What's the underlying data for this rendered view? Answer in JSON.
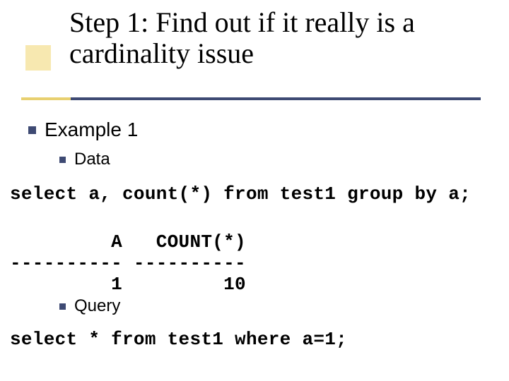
{
  "title": "Step 1: Find out if it really is a cardinality issue",
  "bullets": {
    "example": "Example 1",
    "data": "Data",
    "query": "Query"
  },
  "code": {
    "select1": "select a, count(*) from test1 group by a;",
    "header": "         A   COUNT(*)",
    "divider": "---------- ----------",
    "row": "         1         10",
    "select2": "select * from test1 where a=1;"
  }
}
